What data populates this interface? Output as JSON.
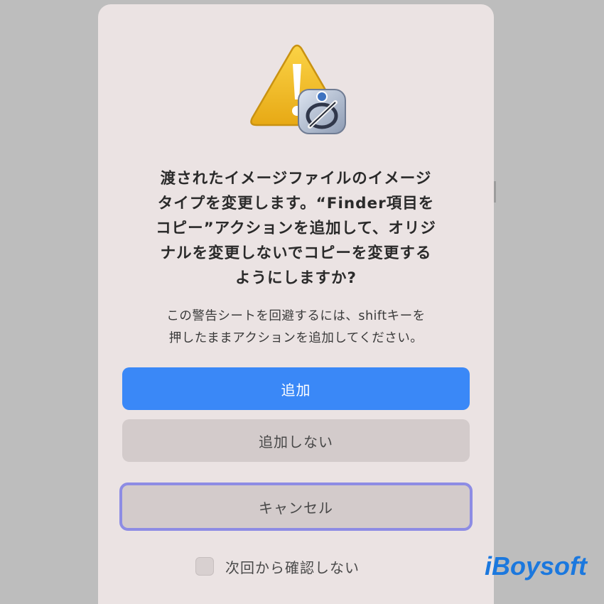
{
  "dialog": {
    "title_lines": [
      "渡されたイメージファイルのイメージ",
      "タイプを変更します。“Finder項目を",
      "コピー”アクションを追加して、オリジ",
      "ナルを変更しないでコピーを変更する",
      "ようにしますか?"
    ],
    "info_lines": [
      "この警告シートを回避するには、shiftキーを",
      "押したままアクションを追加してください。"
    ],
    "buttons": {
      "add": "追加",
      "dont_add": "追加しない",
      "cancel": "キャンセル"
    },
    "suppress_checkbox": {
      "label": "次回から確認しない",
      "checked": false
    },
    "icons": {
      "alert": "warning-triangle-icon",
      "app_badge": "automator-robot-icon"
    }
  },
  "watermark": {
    "text": "iBoysoft"
  },
  "colors": {
    "primary_button": "#3a88f7",
    "secondary_button": "#d3cbcb",
    "dialog_background": "#ebe3e3",
    "page_background": "#bdbdbd",
    "focus_ring": "#8d8ce4",
    "warning": "#f2bd1d",
    "watermark": "#1b78de"
  }
}
